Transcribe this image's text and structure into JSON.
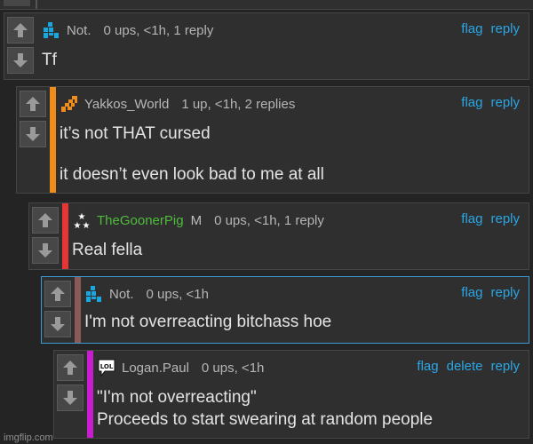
{
  "actions": {
    "flag": "flag",
    "reply": "reply",
    "delete": "delete"
  },
  "comments": [
    {
      "username": "Not.",
      "meta": "0 ups, <1h, 1 reply",
      "lines": [
        "Tf"
      ],
      "stripe_color": "#2f2f2f",
      "avatar": "blue-pixel-icon"
    },
    {
      "username": "Yakkos_World",
      "meta": "1 up, <1h, 2 replies",
      "lines": [
        "it’s not THAT cursed",
        "it doesn’t even look bad to me at all"
      ],
      "stripe_color": "#f08c1c",
      "avatar": "orange-pixel-icon"
    },
    {
      "username": "TheGoonerPig",
      "mod_tag": "M",
      "meta": "0 ups, <1h, 1 reply",
      "lines": [
        "Real fella"
      ],
      "stripe_color": "#e53535",
      "avatar": "stars-icon"
    },
    {
      "username": "Not.",
      "meta": "0 ups, <1h",
      "lines": [
        "I'm not overreacting bitchass hoe"
      ],
      "stripe_color": "#8a5a5a",
      "avatar": "blue-pixel-icon"
    },
    {
      "username": "Logan.Paul",
      "meta": "0 ups, <1h",
      "lines": [
        "\"I'm not overreacting\"",
        "Proceeds to start swearing at random people"
      ],
      "stripe_color": "#c81ccf",
      "avatar": "lol-icon"
    }
  ],
  "watermark": "imgflip.com"
}
